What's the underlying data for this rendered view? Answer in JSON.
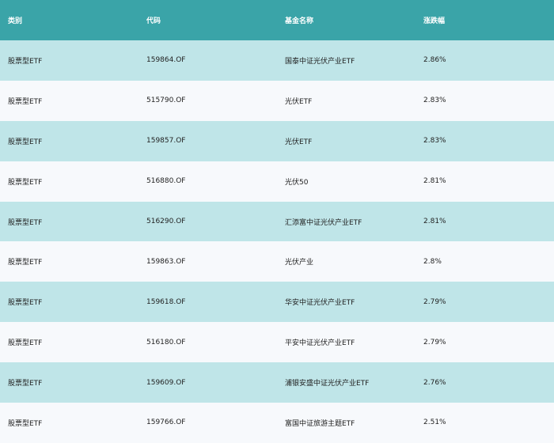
{
  "colors": {
    "header_bg": "#3aa4a8",
    "row_odd_bg": "#bfe5e8",
    "row_even_bg": "#f7f9fc",
    "header_text": "#ffffff",
    "body_text": "#222222"
  },
  "table": {
    "headers": [
      "类别",
      "代码",
      "基金名称",
      "涨跌幅"
    ],
    "rows": [
      [
        "股票型ETF",
        "159864.OF",
        "国泰中证光伏产业ETF",
        "2.86%"
      ],
      [
        "股票型ETF",
        "515790.OF",
        "光伏ETF",
        "2.83%"
      ],
      [
        "股票型ETF",
        "159857.OF",
        "光伏ETF",
        "2.83%"
      ],
      [
        "股票型ETF",
        "516880.OF",
        "光伏50",
        "2.81%"
      ],
      [
        "股票型ETF",
        "516290.OF",
        "汇添富中证光伏产业ETF",
        "2.81%"
      ],
      [
        "股票型ETF",
        "159863.OF",
        "光伏产业",
        "2.8%"
      ],
      [
        "股票型ETF",
        "159618.OF",
        "华安中证光伏产业ETF",
        "2.79%"
      ],
      [
        "股票型ETF",
        "516180.OF",
        "平安中证光伏产业ETF",
        "2.79%"
      ],
      [
        "股票型ETF",
        "159609.OF",
        "浦银安盛中证光伏产业ETF",
        "2.76%"
      ],
      [
        "股票型ETF",
        "159766.OF",
        "富国中证旅游主题ETF",
        "2.51%"
      ]
    ]
  }
}
